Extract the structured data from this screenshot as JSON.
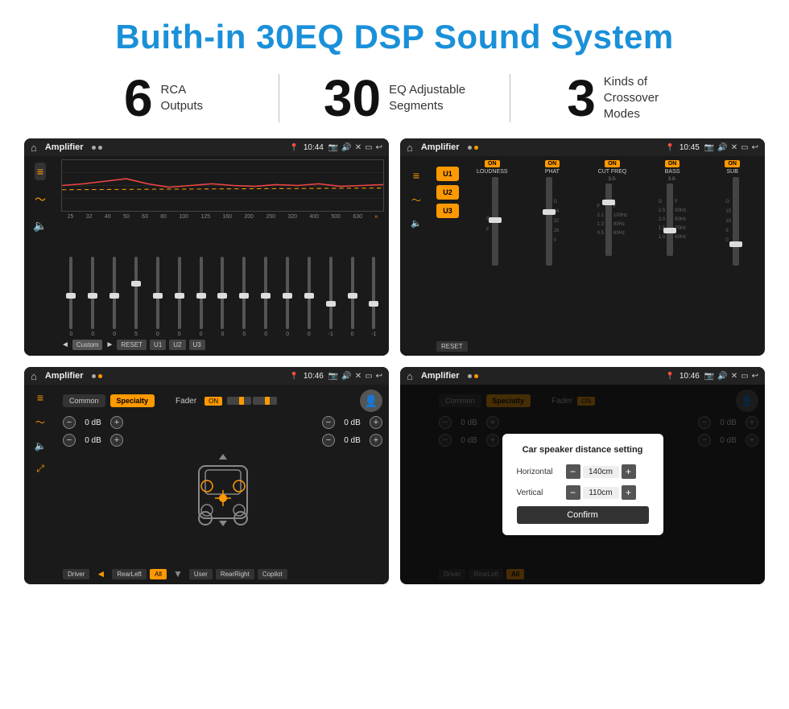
{
  "header": {
    "title": "Buith-in 30EQ DSP Sound System"
  },
  "stats": [
    {
      "number": "6",
      "label": "RCA\nOutputs"
    },
    {
      "number": "30",
      "label": "EQ Adjustable\nSegments"
    },
    {
      "number": "3",
      "label": "Kinds of\nCrossover Modes"
    }
  ],
  "screens": [
    {
      "id": "eq-screen",
      "status_bar": {
        "app": "Amplifier",
        "time": "10:44",
        "dots": [
          "gray",
          "gray"
        ]
      }
    },
    {
      "id": "amp2-screen",
      "status_bar": {
        "app": "Amplifier",
        "time": "10:45",
        "dots": [
          "gray",
          "orange"
        ]
      }
    },
    {
      "id": "fader-screen",
      "status_bar": {
        "app": "Amplifier",
        "time": "10:46",
        "dots": [
          "gray",
          "orange"
        ]
      }
    },
    {
      "id": "dialog-screen",
      "status_bar": {
        "app": "Amplifier",
        "time": "10:46",
        "dots": [
          "gray",
          "orange"
        ]
      },
      "dialog": {
        "title": "Car speaker distance setting",
        "horizontal_label": "Horizontal",
        "horizontal_value": "140cm",
        "vertical_label": "Vertical",
        "vertical_value": "110cm",
        "confirm_label": "Confirm"
      }
    }
  ],
  "eq_freqs": [
    "25",
    "32",
    "40",
    "50",
    "63",
    "80",
    "100",
    "125",
    "160",
    "200",
    "250",
    "320",
    "400",
    "500",
    "630"
  ],
  "eq_vals": [
    "0",
    "0",
    "0",
    "5",
    "0",
    "0",
    "0",
    "0",
    "0",
    "0",
    "0",
    "0",
    "-1",
    "0",
    "-1"
  ],
  "eq_slider_positions": [
    50,
    50,
    50,
    35,
    50,
    50,
    50,
    50,
    50,
    50,
    50,
    50,
    60,
    50,
    60
  ],
  "eq_presets": [
    "Custom",
    "RESET",
    "U1",
    "U2",
    "U3"
  ],
  "amp2_presets": [
    "U1",
    "U2",
    "U3"
  ],
  "amp2_channels": [
    {
      "label": "LOUDNESS",
      "on": true
    },
    {
      "label": "PHAT",
      "on": true
    },
    {
      "label": "CUT FREQ",
      "on": true
    },
    {
      "label": "BASS",
      "on": true
    },
    {
      "label": "SUB",
      "on": true
    }
  ],
  "fader": {
    "tabs": [
      "Common",
      "Specialty"
    ],
    "active_tab": "Specialty",
    "fader_label": "Fader",
    "on_label": "ON",
    "db_values": [
      "0 dB",
      "0 dB",
      "0 dB",
      "0 dB"
    ],
    "bottom_btns": [
      "Driver",
      "RearLeft",
      "All",
      "User",
      "RearRight",
      "Copilot"
    ]
  },
  "dialog": {
    "title": "Car speaker distance setting",
    "horizontal_label": "Horizontal",
    "horizontal_value": "140cm",
    "vertical_label": "Vertical",
    "vertical_value": "110cm",
    "confirm_label": "Confirm"
  }
}
